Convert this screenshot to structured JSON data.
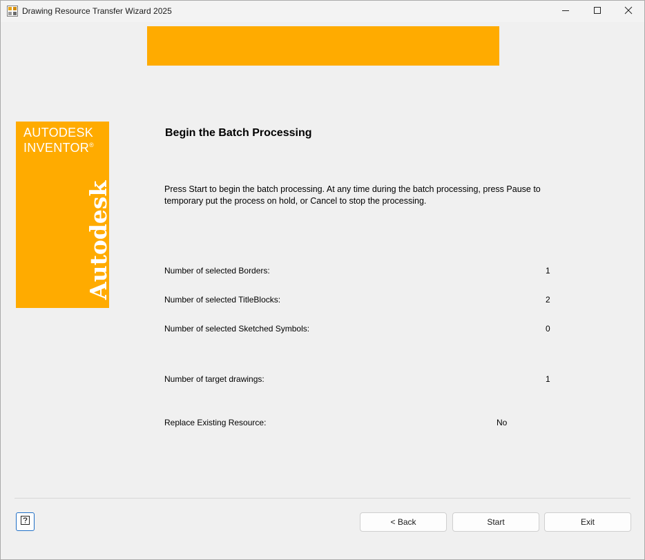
{
  "window": {
    "title": "Drawing Resource Transfer Wizard 2025",
    "icons": {
      "app": "app-icon",
      "minimize": "minimize-icon",
      "maximize": "maximize-icon",
      "close": "close-icon"
    }
  },
  "branding": {
    "line1": "AUTODESK",
    "line2": "INVENTOR",
    "trademark": "®",
    "vertical_logo": "Autodesk",
    "color": "#ffab00"
  },
  "page": {
    "heading": "Begin the Batch Processing",
    "intro": "Press Start to begin the batch processing. At any time during the batch processing, press Pause to temporary put the process on hold, or Cancel to stop the processing."
  },
  "stats": [
    {
      "label": "Number of selected Borders:",
      "value": "1"
    },
    {
      "label": "Number of selected TitleBlocks:",
      "value": "2"
    },
    {
      "label": "Number of selected Sketched Symbols:",
      "value": "0"
    },
    {
      "label": "Number of target drawings:",
      "value": "1"
    },
    {
      "label": "Replace Existing Resource:",
      "value": "No"
    }
  ],
  "footer": {
    "help_icon": "help-icon",
    "back_label": "< Back",
    "start_label": "Start",
    "exit_label": "Exit"
  }
}
